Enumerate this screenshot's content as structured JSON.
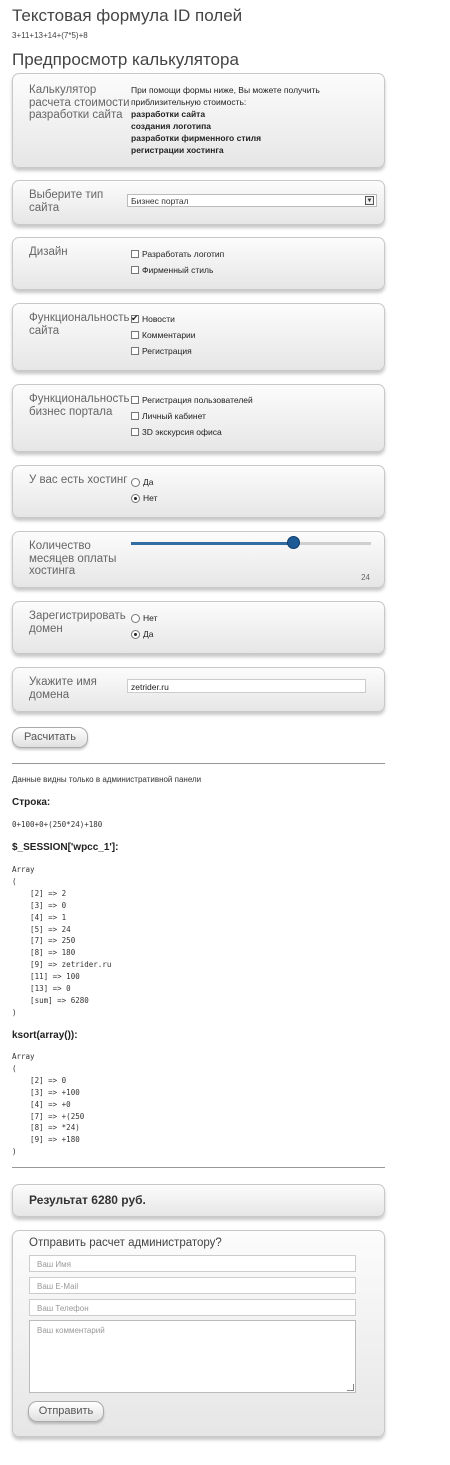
{
  "page_title": "Текстовая формула ID полей",
  "formula": "3+11+13+14+(7*5)+8",
  "preview_title": "Предпросмотр калькулятора",
  "intro": {
    "label": "Калькулятор расчета стоимости разработки сайта",
    "text": "При помощи формы ниже, Вы можете получить приблизительную стоимость:",
    "items": [
      "разработки сайта",
      "создания логотипа",
      "разработки фирменного стиля",
      "регистрации хостинга"
    ]
  },
  "site_type": {
    "label": "Выберите тип сайта",
    "selected": "Бизнес портал"
  },
  "design": {
    "label": "Дизайн",
    "options": [
      {
        "text": "Разработать логотип",
        "checked": false
      },
      {
        "text": "Фирменный стиль",
        "checked": false
      }
    ]
  },
  "site_func": {
    "label": "Функциональность сайта",
    "options": [
      {
        "text": "Новости",
        "checked": true
      },
      {
        "text": "Комментарии",
        "checked": false
      },
      {
        "text": "Регистрация",
        "checked": false
      }
    ]
  },
  "portal_func": {
    "label": "Функциональность бизнес портала",
    "options": [
      {
        "text": "Регистрация пользователей",
        "checked": false
      },
      {
        "text": "Личный кабинет",
        "checked": false
      },
      {
        "text": "3D экскурсия офиса",
        "checked": false
      }
    ]
  },
  "hosting": {
    "label": "У вас есть хостинг",
    "options": [
      {
        "text": "Да",
        "checked": false
      },
      {
        "text": "Нет",
        "checked": true
      }
    ]
  },
  "months": {
    "label": "Количество месяцев оплаты хостинга",
    "value": "24",
    "fill_fraction": 0.68
  },
  "domain_reg": {
    "label": "Зарегистрировать домен",
    "options": [
      {
        "text": "Нет",
        "checked": false
      },
      {
        "text": "Да",
        "checked": true
      }
    ]
  },
  "domain_name": {
    "label": "Укажите имя домена",
    "value": "zetrider.ru"
  },
  "calculate_label": "Расчитать",
  "admin_note": "Данные видны только в административной панели",
  "string_label": "Строка:",
  "string_value": "0+100+0+(250*24)+180",
  "session_label": "$_SESSION['wpcc_1']:",
  "session_dump": "Array\n(\n    [2] => 2\n    [3] => 0\n    [4] => 1\n    [5] => 24\n    [7] => 250\n    [8] => 180\n    [9] => zetrider.ru\n    [11] => 100\n    [13] => 0\n    [sum] => 6280\n)",
  "ksort_label": "ksort(array()):",
  "ksort_dump": "Array\n(\n    [2] => 0\n    [3] => +100\n    [4] => +0\n    [7] => +(250\n    [8] => *24)\n    [9] => +180\n)",
  "result": "Результат 6280 руб.",
  "send": {
    "title": "Отправить расчет администратору?",
    "name_placeholder": "Ваш Имя",
    "email_placeholder": "Ваш E-Mail",
    "phone_placeholder": "Ваш Телефон",
    "comment_placeholder": "Ваш комментарий",
    "submit_label": "Отправить"
  }
}
